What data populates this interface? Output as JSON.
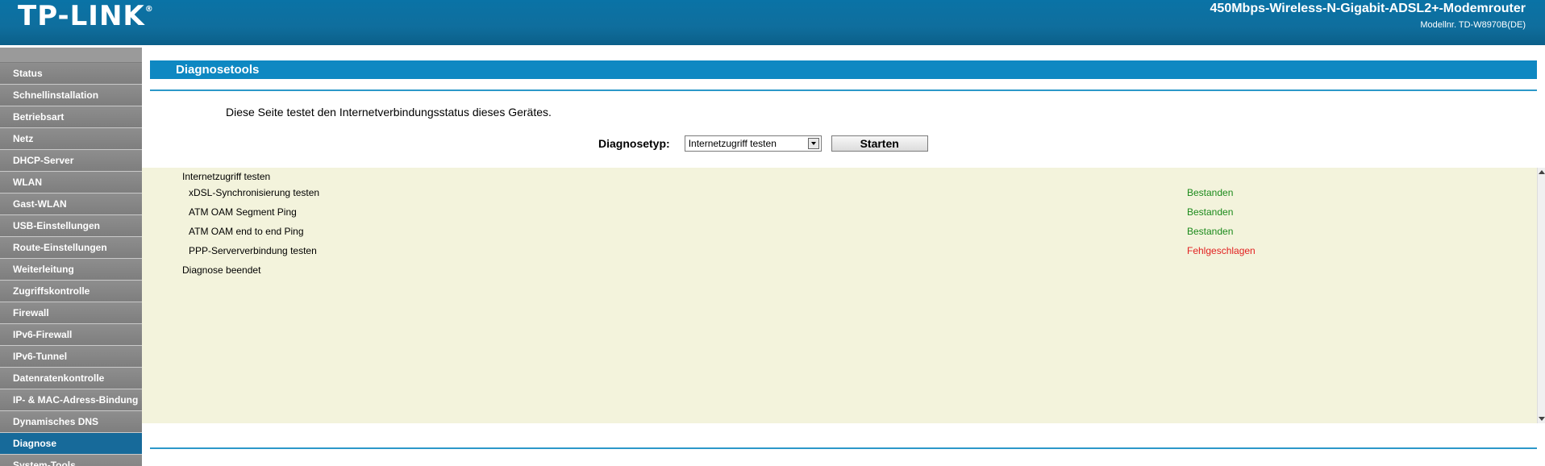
{
  "header": {
    "logo": "TP-LINK",
    "product": "450Mbps-Wireless-N-Gigabit-ADSL2+-Modemrouter",
    "model": "Modellnr. TD-W8970B(DE)"
  },
  "sidebar": {
    "items": [
      {
        "label": "Status"
      },
      {
        "label": "Schnellinstallation"
      },
      {
        "label": "Betriebsart"
      },
      {
        "label": "Netz"
      },
      {
        "label": "DHCP-Server"
      },
      {
        "label": "WLAN"
      },
      {
        "label": "Gast-WLAN"
      },
      {
        "label": "USB-Einstellungen"
      },
      {
        "label": "Route-Einstellungen"
      },
      {
        "label": "Weiterleitung"
      },
      {
        "label": "Zugriffskontrolle"
      },
      {
        "label": "Firewall"
      },
      {
        "label": "IPv6-Firewall"
      },
      {
        "label": "IPv6-Tunnel"
      },
      {
        "label": "Datenratenkontrolle"
      },
      {
        "label": "IP- & MAC-Adress-Bindung"
      },
      {
        "label": "Dynamisches DNS"
      },
      {
        "label": "Diagnose"
      },
      {
        "label": "System-Tools"
      }
    ],
    "active": "Diagnose"
  },
  "main": {
    "title": "Diagnosetools",
    "intro": "Diese Seite testet den Internetverbindungsstatus dieses Gerätes.",
    "diag_label": "Diagnosetyp:",
    "diag_select_value": "Internetzugriff testen",
    "start_button": "Starten",
    "results": {
      "heading": "Internetzugriff testen",
      "tests": [
        {
          "name": "xDSL-Synchronisierung testen",
          "status": "Bestanden"
        },
        {
          "name": "ATM OAM Segment Ping",
          "status": "Bestanden"
        },
        {
          "name": "ATM OAM end to end Ping",
          "status": "Bestanden"
        },
        {
          "name": "PPP-Serververbindung testen",
          "status": "Fehlgeschlagen"
        }
      ],
      "footer": "Diagnose beendet"
    }
  },
  "colors": {
    "header": "#0b6fa0",
    "title_bar": "#0e88c2",
    "pass": "#1b8a1b",
    "fail": "#e22020",
    "result_bg": "#f3f3dc"
  }
}
